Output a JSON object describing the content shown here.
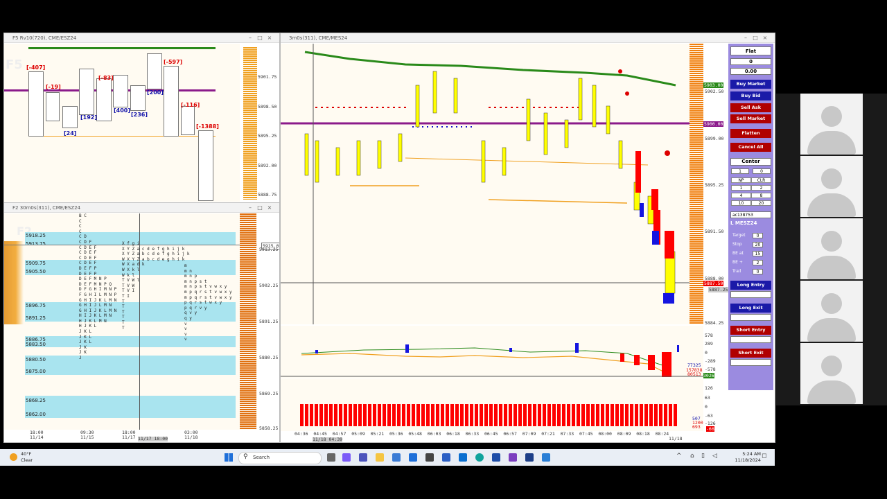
{
  "windows": {
    "f5": {
      "title": "F5 Rv10(720), CME/ESZ24",
      "watermark": "F5",
      "prices": [
        "5901.75",
        "5898.50",
        "5895.25",
        "5892.00",
        "5888.75"
      ],
      "deltas": [
        "[-407]",
        "[-19]",
        "[-83]",
        "[-597]",
        "[-116]",
        "[-1388]"
      ],
      "pos_deltas": [
        "[24]",
        "[192]",
        "[400]",
        "[236]",
        "[200]"
      ]
    },
    "f2": {
      "title": "F2 30m0s(311), CME/ESZ24",
      "watermark": "F2",
      "levels": [
        "5918.25",
        "5913.75",
        "5909.75",
        "5905.50",
        "5896.75",
        "5891.25",
        "5886.75",
        "5883.50",
        "5880.50",
        "5875.00",
        "5868.25",
        "5862.00"
      ],
      "prices": [
        "5913.25",
        "5902.25",
        "5891.25",
        "5880.25",
        "5869.25",
        "5858.25"
      ],
      "current_price": "5915.00",
      "time_labels": [
        {
          "t": "18:00",
          "d": "11/14"
        },
        {
          "t": "09:30",
          "d": "11/15"
        },
        {
          "t": "18:00",
          "d": "11/17"
        },
        {
          "t": "03:00",
          "d": "11/18"
        }
      ],
      "cursor_time": "11/17 18:00",
      "profile_rows": [
        "B C",
        "C",
        "C",
        "C",
        "C D",
        "C D F",
        "C D E F",
        "C D E F",
        "C D E F",
        "C D E F",
        "D E F P",
        "D E F P",
        "D E F M N P",
        "D E F M N P Q",
        "D F G H I M N P",
        "F G H I L M N P",
        "G H I J K L M N",
        "G H I J L M N",
        "G H I J K L M N",
        "H I J K L M N",
        "H J K L M N",
        "H J K L",
        "J K L",
        "J K L",
        "J K L",
        "J K",
        "J K",
        "J"
      ],
      "profile2_rows": [
        "X f g i",
        "X Y Z a c d e f g h i j k",
        "X Y Z a b c d e f g h i j k",
        "W X Y Z a b c d e g h i k",
        "W X a d k",
        "W X k l",
        "W k l",
        "T V W l",
        "T V W",
        "T V I",
        "T I",
        "T",
        "T",
        "T",
        "T",
        "T",
        "T"
      ],
      "profile3_rows": [
        "m",
        "m n",
        "m n p",
        "m n p s t",
        "m n p s t v w x y",
        "m p q r s t v w x y",
        "m p q r s t v w x y",
        "p q r s t w x y",
        "p q r v y",
        "q v y",
        "q y",
        "v",
        "v",
        "v",
        "v"
      ]
    },
    "main": {
      "title": "3m0s(311), CME/MES24",
      "prices": [
        "5902.50",
        "5899.00",
        "5895.25",
        "5891.50",
        "5888.00",
        "5884.25"
      ],
      "price_tags": {
        "green": "5903.00",
        "purple": "5900.00",
        "red": "5887.50",
        "grey": "5887.25"
      },
      "times": [
        "04:36",
        "04:45",
        "04:57",
        "05:09",
        "05:21",
        "05:36",
        "05:48",
        "06:03",
        "06:18",
        "06:33",
        "06:45",
        "06:57",
        "07:09",
        "07:21",
        "07:33",
        "07:45",
        "08:00",
        "08:09",
        "08:18",
        "08:24"
      ],
      "time_date": "11/18",
      "cursor_time": "11/18 04:39",
      "ind1_scale": [
        "578",
        "289",
        "0",
        "-289",
        "-578"
      ],
      "ind1_values": [
        "77325",
        "157838",
        "80513",
        "3026"
      ],
      "ind2_scale": [
        "126",
        "63",
        "0",
        "-63",
        "-126"
      ],
      "ind2_values": [
        "507",
        "1200",
        "693"
      ],
      "ind2_tag": "-66"
    }
  },
  "panel": {
    "position": "Flat",
    "qty": "0",
    "pnl": "0.00",
    "buttons": [
      "Buy Market",
      "Buy Bid",
      "Sell Ask",
      "Sell Market",
      "Flatten",
      "Cancel All"
    ],
    "center_label": "Center",
    "qty_spinner": "1",
    "qty_right": "0",
    "grid": [
      [
        "NP",
        "CLR"
      ],
      [
        "1",
        "2"
      ],
      [
        "4",
        "8"
      ],
      [
        "10",
        "20"
      ]
    ],
    "account": "ac138753",
    "symbol": "L MESZ24",
    "fields": [
      {
        "label": "Target",
        "value": "0"
      },
      {
        "label": "Stop",
        "value": "20"
      },
      {
        "label": "BE at",
        "value": "15"
      },
      {
        "label": "BE +",
        "value": "2"
      },
      {
        "label": "Trail",
        "value": "0"
      }
    ],
    "entry_buttons": [
      "Long Entry",
      "Long Exit",
      "Short Entry",
      "Short Exit"
    ]
  },
  "taskbar": {
    "temperature": "40°F",
    "weather": "Clear",
    "search_placeholder": "Search",
    "time": "5:24 AM",
    "date": "11/18/2024"
  },
  "colors": {
    "buy": "#1a1aa8",
    "sell": "#b00000",
    "flatten": "#b00000",
    "panel": "#9b8be0",
    "profile_bar": "#f0a020",
    "value_area": "#a9e4ef"
  }
}
